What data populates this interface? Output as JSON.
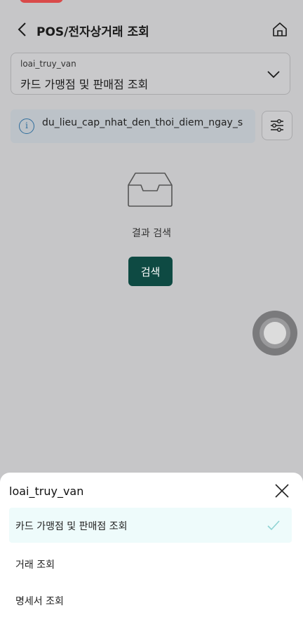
{
  "header": {
    "title": "POS/전자상거래 조회",
    "back_icon": "chevron-left-icon",
    "home_icon": "home-icon"
  },
  "query_select": {
    "label": "loai_truy_van",
    "value": "카드 가맹점 및 판매점 조회"
  },
  "info_banner": {
    "text": "du_lieu_cap_nhat_den_thoi_diem_ngay_s"
  },
  "empty_state": {
    "text": "결과 검색",
    "button_label": "검색"
  },
  "sheet": {
    "title": "loai_truy_van",
    "options": [
      {
        "label": "카드 가맹점 및 판매점 조회",
        "selected": true
      },
      {
        "label": "거래 조회",
        "selected": false
      },
      {
        "label": "명세서 조회",
        "selected": false
      }
    ]
  },
  "colors": {
    "primary_button": "#0e4a43",
    "info_icon": "#2f6d9c",
    "selected_option_bg": "#eefbfb",
    "check": "#8fd3d3"
  }
}
